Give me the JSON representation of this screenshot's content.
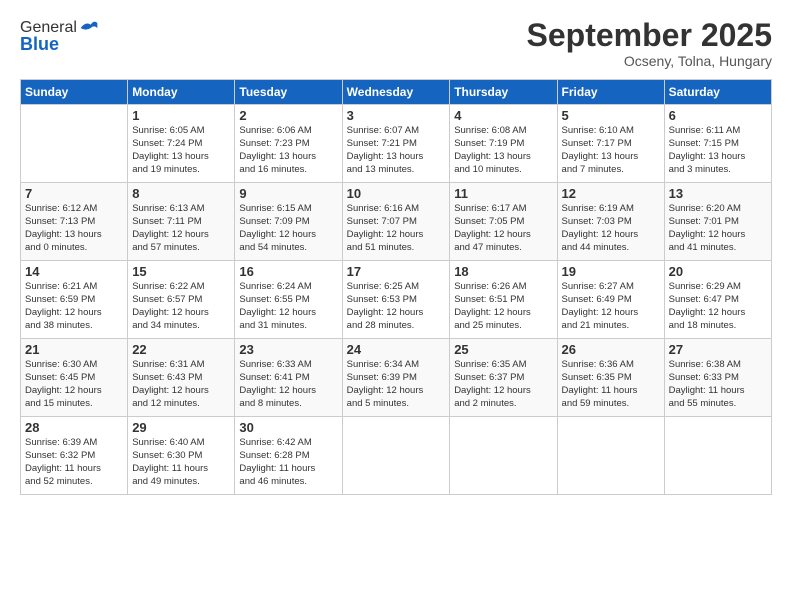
{
  "header": {
    "logo_general": "General",
    "logo_blue": "Blue",
    "month_title": "September 2025",
    "subtitle": "Ocseny, Tolna, Hungary"
  },
  "days_of_week": [
    "Sunday",
    "Monday",
    "Tuesday",
    "Wednesday",
    "Thursday",
    "Friday",
    "Saturday"
  ],
  "weeks": [
    [
      {
        "day": "",
        "info": ""
      },
      {
        "day": "1",
        "info": "Sunrise: 6:05 AM\nSunset: 7:24 PM\nDaylight: 13 hours\nand 19 minutes."
      },
      {
        "day": "2",
        "info": "Sunrise: 6:06 AM\nSunset: 7:23 PM\nDaylight: 13 hours\nand 16 minutes."
      },
      {
        "day": "3",
        "info": "Sunrise: 6:07 AM\nSunset: 7:21 PM\nDaylight: 13 hours\nand 13 minutes."
      },
      {
        "day": "4",
        "info": "Sunrise: 6:08 AM\nSunset: 7:19 PM\nDaylight: 13 hours\nand 10 minutes."
      },
      {
        "day": "5",
        "info": "Sunrise: 6:10 AM\nSunset: 7:17 PM\nDaylight: 13 hours\nand 7 minutes."
      },
      {
        "day": "6",
        "info": "Sunrise: 6:11 AM\nSunset: 7:15 PM\nDaylight: 13 hours\nand 3 minutes."
      }
    ],
    [
      {
        "day": "7",
        "info": "Sunrise: 6:12 AM\nSunset: 7:13 PM\nDaylight: 13 hours\nand 0 minutes."
      },
      {
        "day": "8",
        "info": "Sunrise: 6:13 AM\nSunset: 7:11 PM\nDaylight: 12 hours\nand 57 minutes."
      },
      {
        "day": "9",
        "info": "Sunrise: 6:15 AM\nSunset: 7:09 PM\nDaylight: 12 hours\nand 54 minutes."
      },
      {
        "day": "10",
        "info": "Sunrise: 6:16 AM\nSunset: 7:07 PM\nDaylight: 12 hours\nand 51 minutes."
      },
      {
        "day": "11",
        "info": "Sunrise: 6:17 AM\nSunset: 7:05 PM\nDaylight: 12 hours\nand 47 minutes."
      },
      {
        "day": "12",
        "info": "Sunrise: 6:19 AM\nSunset: 7:03 PM\nDaylight: 12 hours\nand 44 minutes."
      },
      {
        "day": "13",
        "info": "Sunrise: 6:20 AM\nSunset: 7:01 PM\nDaylight: 12 hours\nand 41 minutes."
      }
    ],
    [
      {
        "day": "14",
        "info": "Sunrise: 6:21 AM\nSunset: 6:59 PM\nDaylight: 12 hours\nand 38 minutes."
      },
      {
        "day": "15",
        "info": "Sunrise: 6:22 AM\nSunset: 6:57 PM\nDaylight: 12 hours\nand 34 minutes."
      },
      {
        "day": "16",
        "info": "Sunrise: 6:24 AM\nSunset: 6:55 PM\nDaylight: 12 hours\nand 31 minutes."
      },
      {
        "day": "17",
        "info": "Sunrise: 6:25 AM\nSunset: 6:53 PM\nDaylight: 12 hours\nand 28 minutes."
      },
      {
        "day": "18",
        "info": "Sunrise: 6:26 AM\nSunset: 6:51 PM\nDaylight: 12 hours\nand 25 minutes."
      },
      {
        "day": "19",
        "info": "Sunrise: 6:27 AM\nSunset: 6:49 PM\nDaylight: 12 hours\nand 21 minutes."
      },
      {
        "day": "20",
        "info": "Sunrise: 6:29 AM\nSunset: 6:47 PM\nDaylight: 12 hours\nand 18 minutes."
      }
    ],
    [
      {
        "day": "21",
        "info": "Sunrise: 6:30 AM\nSunset: 6:45 PM\nDaylight: 12 hours\nand 15 minutes."
      },
      {
        "day": "22",
        "info": "Sunrise: 6:31 AM\nSunset: 6:43 PM\nDaylight: 12 hours\nand 12 minutes."
      },
      {
        "day": "23",
        "info": "Sunrise: 6:33 AM\nSunset: 6:41 PM\nDaylight: 12 hours\nand 8 minutes."
      },
      {
        "day": "24",
        "info": "Sunrise: 6:34 AM\nSunset: 6:39 PM\nDaylight: 12 hours\nand 5 minutes."
      },
      {
        "day": "25",
        "info": "Sunrise: 6:35 AM\nSunset: 6:37 PM\nDaylight: 12 hours\nand 2 minutes."
      },
      {
        "day": "26",
        "info": "Sunrise: 6:36 AM\nSunset: 6:35 PM\nDaylight: 11 hours\nand 59 minutes."
      },
      {
        "day": "27",
        "info": "Sunrise: 6:38 AM\nSunset: 6:33 PM\nDaylight: 11 hours\nand 55 minutes."
      }
    ],
    [
      {
        "day": "28",
        "info": "Sunrise: 6:39 AM\nSunset: 6:32 PM\nDaylight: 11 hours\nand 52 minutes."
      },
      {
        "day": "29",
        "info": "Sunrise: 6:40 AM\nSunset: 6:30 PM\nDaylight: 11 hours\nand 49 minutes."
      },
      {
        "day": "30",
        "info": "Sunrise: 6:42 AM\nSunset: 6:28 PM\nDaylight: 11 hours\nand 46 minutes."
      },
      {
        "day": "",
        "info": ""
      },
      {
        "day": "",
        "info": ""
      },
      {
        "day": "",
        "info": ""
      },
      {
        "day": "",
        "info": ""
      }
    ]
  ]
}
